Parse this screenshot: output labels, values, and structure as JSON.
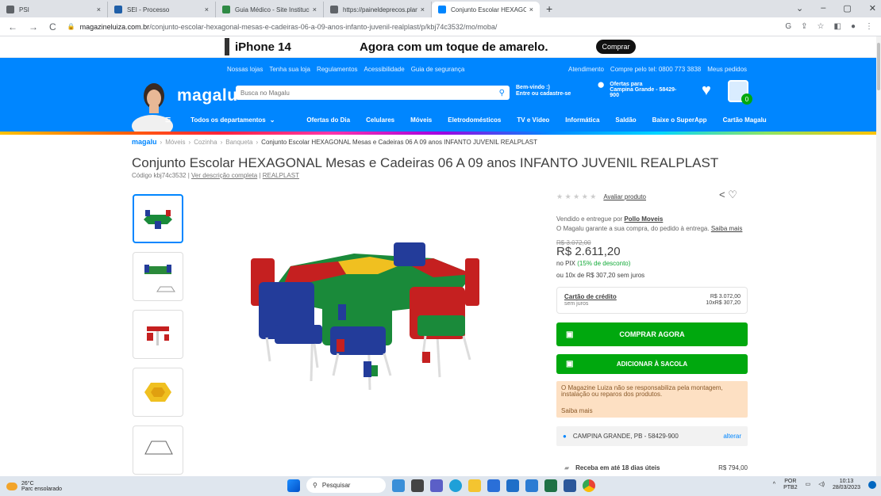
{
  "browser": {
    "tabs": [
      {
        "label": "PSI",
        "color": "#5f6368",
        "active": false
      },
      {
        "label": "SEI - Processo",
        "color": "#1f5fa8",
        "active": false
      },
      {
        "label": "Guia Médico - Site Institucional",
        "color": "#2f8a45",
        "active": false
      },
      {
        "label": "https://paineldeprecos.planejam...",
        "color": "#5f6368",
        "active": false
      },
      {
        "label": "Conjunto Escolar HEXAGONAL M...",
        "color": "#0086ff",
        "active": true
      }
    ],
    "url_host": "magazineluiza.com.br",
    "url_path": "/conjunto-escolar-hexagonal-mesas-e-cadeiras-06-a-09-anos-infanto-juvenil-realplast/p/kbj74c3532/mo/moba/"
  },
  "promo": {
    "product": "iPhone 14",
    "message": "Agora com um toque de amarelo.",
    "button": "Comprar"
  },
  "header": {
    "top_links": [
      "Nossas lojas",
      "Tenha sua loja",
      "Regulamentos",
      "Acessibilidade",
      "Guia de segurança"
    ],
    "top_links_right": [
      "Atendimento",
      "Compre pelo tel: 0800 773 3838",
      "Meus pedidos"
    ],
    "logo": "magalu",
    "search_placeholder": "Busca no Magalu",
    "welcome_line1": "Bem-vindo :)",
    "welcome_line2": "Entre ou cadastre-se",
    "offers_line1": "Ofertas para",
    "offers_line2": "Campina Grande - 58429-900",
    "cart_count": "0",
    "menu": [
      "Todos os departamentos",
      "Ofertas do Dia",
      "Celulares",
      "Móveis",
      "Eletrodomésticos",
      "TV e Vídeo",
      "Informática",
      "Saldão",
      "Baixe o SuperApp",
      "Cartão Magalu"
    ]
  },
  "breadcrumb": {
    "home": "magalu",
    "items": [
      "Móveis",
      "Cozinha",
      "Banqueta"
    ],
    "current": "Conjunto Escolar HEXAGONAL Mesas e Cadeiras 06 A 09 anos INFANTO JUVENIL REALPLAST"
  },
  "product": {
    "title": "Conjunto Escolar HEXAGONAL Mesas e Cadeiras 06 A 09 anos INFANTO JUVENIL REALPLAST",
    "code": "Código kbj74c3532",
    "desc_link": "Ver descrição completa",
    "brand": "REALPLAST",
    "rating_link": "Avaliar produto",
    "seller_prefix": "Vendido e entregue por",
    "seller": "Pollo Moveis",
    "guarantee": "O Magalu garante a sua compra, do pedido à entrega.",
    "guarantee_link": "Saiba mais",
    "old_price": "R$ 3.072,00",
    "price": "R$ 2.611,20",
    "pix_prefix": "no PIX",
    "pix_discount": "(15% de desconto)",
    "installments": "ou 10x de R$ 307,20 sem juros",
    "card_label": "Cartão de crédito",
    "card_sub": "sem juros",
    "card_total": "R$ 3.072,00",
    "card_install": "10xR$ 307,20",
    "buy_now": "COMPRAR AGORA",
    "add_bag": "ADICIONAR À SACOLA",
    "warning": "O Magazine Luiza não se responsabiliza pela montagem, instalação ou reparos dos produtos.",
    "warning_link": "Saiba mais",
    "location": "CAMPINA GRANDE, PB - 58429-900",
    "change": "alterar",
    "delivery": "Receba em até 18 dias úteis",
    "delivery_price": "R$ 794,00"
  },
  "taskbar": {
    "temp": "26°C",
    "weather": "Parc ensolarado",
    "search": "Pesquisar",
    "lang": "POR",
    "layout": "PTB2",
    "time": "10:13",
    "date": "28/03/2023"
  }
}
